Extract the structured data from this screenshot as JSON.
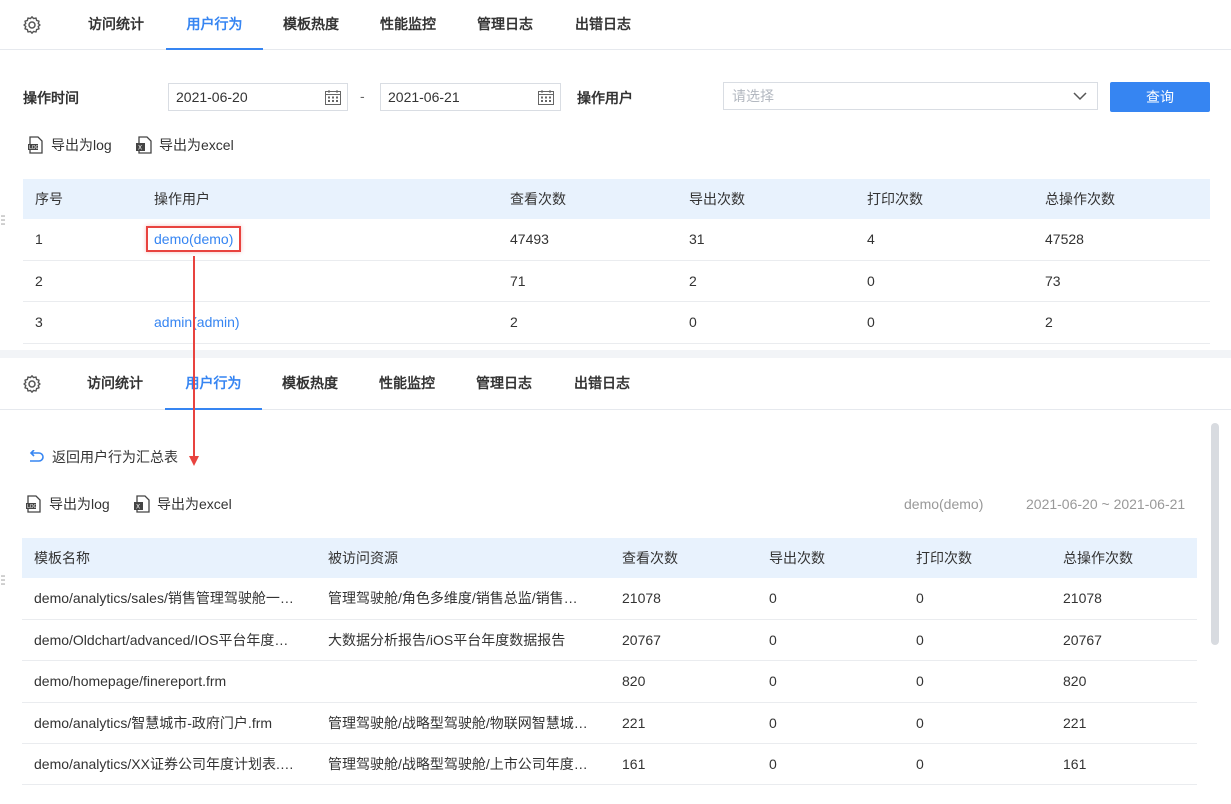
{
  "tabs": [
    "访问统计",
    "用户行为",
    "模板热度",
    "性能监控",
    "管理日志",
    "出错日志"
  ],
  "active_tab": "用户行为",
  "filters": {
    "time_label": "操作时间",
    "date_from": "2021-06-20",
    "date_sep": "-",
    "date_to": "2021-06-21",
    "user_label": "操作用户",
    "user_placeholder": "请选择",
    "query_button": "查询"
  },
  "export": {
    "log": "导出为log",
    "excel": "导出为excel"
  },
  "summary_table": {
    "columns": [
      "序号",
      "操作用户",
      "查看次数",
      "导出次数",
      "打印次数",
      "总操作次数"
    ],
    "rows": [
      [
        "1",
        "demo(demo)",
        "47493",
        "31",
        "4",
        "47528"
      ],
      [
        "2",
        "",
        "71",
        "2",
        "0",
        "73"
      ],
      [
        "3",
        "admin(admin)",
        "2",
        "0",
        "0",
        "2"
      ]
    ]
  },
  "detail": {
    "back_label": "返回用户行为汇总表",
    "user": "demo(demo)",
    "range": "2021-06-20 ~ 2021-06-21",
    "columns": [
      "模板名称",
      "被访问资源",
      "查看次数",
      "导出次数",
      "打印次数",
      "总操作次数"
    ],
    "rows": [
      [
        "demo/analytics/sales/销售管理驾驶舱一…",
        "管理驾驶舱/角色多维度/销售总监/销售…",
        "21078",
        "0",
        "0",
        "21078"
      ],
      [
        "demo/Oldchart/advanced/IOS平台年度…",
        "大数据分析报告/iOS平台年度数据报告",
        "20767",
        "0",
        "0",
        "20767"
      ],
      [
        "demo/homepage/finereport.frm",
        "",
        "820",
        "0",
        "0",
        "820"
      ],
      [
        "demo/analytics/智慧城市-政府门户.frm",
        "管理驾驶舱/战略型驾驶舱/物联网智慧城…",
        "221",
        "0",
        "0",
        "221"
      ],
      [
        "demo/analytics/XX证券公司年度计划表.…",
        "管理驾驶舱/战略型驾驶舱/上市公司年度…",
        "161",
        "0",
        "0",
        "161"
      ]
    ]
  },
  "colors": {
    "accent": "#3685f2",
    "highlight_border": "#e8433f",
    "header_bg": "#e8f2fd"
  }
}
